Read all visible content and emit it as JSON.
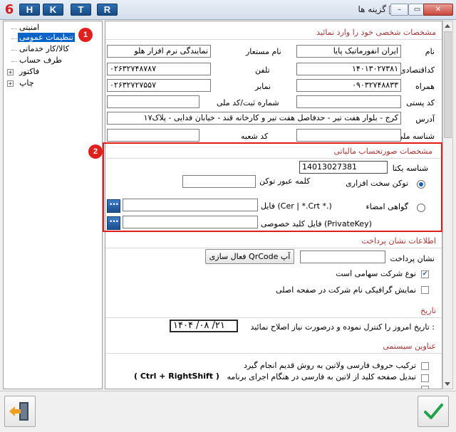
{
  "window": {
    "title": "گزینه ها",
    "logo": "6",
    "shortcut_buttons": [
      "H",
      "K",
      "T",
      "R"
    ],
    "minimize": "–",
    "maximize": "▭",
    "close": "✕"
  },
  "tree": {
    "items": [
      {
        "label": "امنیتی"
      },
      {
        "label": "تنظیمات عمومی",
        "selected": true
      },
      {
        "label": "کالا/کار خدماتی"
      },
      {
        "label": "طرف حساب"
      },
      {
        "label": "فاکتور",
        "expandable": true
      },
      {
        "label": "چاپ",
        "expandable": true
      }
    ],
    "marker": "1"
  },
  "personal": {
    "heading": "مشخصات شخصی خود را وارد نمائید",
    "name_label": "نام",
    "name_value": "ایران انفورماتیک پایا",
    "tenant_label": "نام مستعار",
    "tenant_value": "نمایندگی نرم افزار هلو",
    "econ_label": "کداقتصادی",
    "econ_value": "۱۴۰۱۳۰۲۷۳۸۱",
    "phone_label": "تلفن",
    "phone_value": "۰۲۶۳۲۷۴۸۷۸۷",
    "mobile_label": "همراه",
    "mobile_value": "۰۹۰۳۲۷۴۸۸۳۳",
    "fax_label": "نمابر",
    "fax_value": "۰۲۶۳۲۷۲۷۵۵۷",
    "postal_label": "کد پستی",
    "postal_value": "",
    "regno_label": "شماره ثبت/کد ملی",
    "regno_value": "",
    "address_label": "آدرس",
    "address_value": "کرج - بلوار هفت تیر - حدفاصل هفت تیر و کارخانه قند - خیابان فدایی - پلاک۱۷",
    "nationalid_label": "شناسه ملی",
    "nationalid_value": "",
    "branch_label": "کد شعبه",
    "branch_value": ""
  },
  "tax": {
    "marker": "2",
    "heading": "مشخصات صورتحساب مالیاتی",
    "unique_id_label": "شناسه یکتا",
    "unique_id_value": "14013027381",
    "hw_token_label": "توکن سخت افزاری",
    "token_pass_label": "کلمه عبور توکن",
    "token_pass_value": "",
    "cert_label": "گواهی امضاء",
    "cert_file_label": "فایل (Cer | *.Crt *.)",
    "cert_file_value": "",
    "key_file_label": "فایل کلید خصوصی (PrivateKey)",
    "key_file_value": "",
    "browse": "•••",
    "selected_option": "hw_token"
  },
  "payment": {
    "heading": "اطلاعات نشان پرداخت",
    "address_label": "نشان پرداخت",
    "address_value": "",
    "qrcode_button": "فعال سازی QrCode آپ",
    "joint_stock_label": "نوع شرکت سهامی است",
    "joint_stock_checked": true,
    "graphic_name_label": "نمایش گرافیکی نام شرکت در صفحه اصلی",
    "graphic_name_checked": false
  },
  "date": {
    "heading": "تاریخ",
    "check_label": "تاریخ امروز را کنترل نموده و درصورت نیاز اصلاح نمائید :",
    "value": "۱۴۰۴ /۰۸ /۲۱"
  },
  "system": {
    "heading": "عناوین سیستمی",
    "option1": "ترکیب حروف فارسی ولاتین به روش قدیم انجام گیرد",
    "option2": "تبدیل صفحه کلید از لاتین به فارسی در هنگام اجرای برنامه",
    "option2_hint": "( Ctrl + RightShift )"
  },
  "footer": {
    "exit_icon": "exit-door-icon",
    "ok_icon": "checkmark-icon"
  },
  "colors": {
    "highlight": "#e21b1b",
    "section_title": "#a03838",
    "selection": "#0a64c8",
    "ok_green": "#1fa24a"
  }
}
